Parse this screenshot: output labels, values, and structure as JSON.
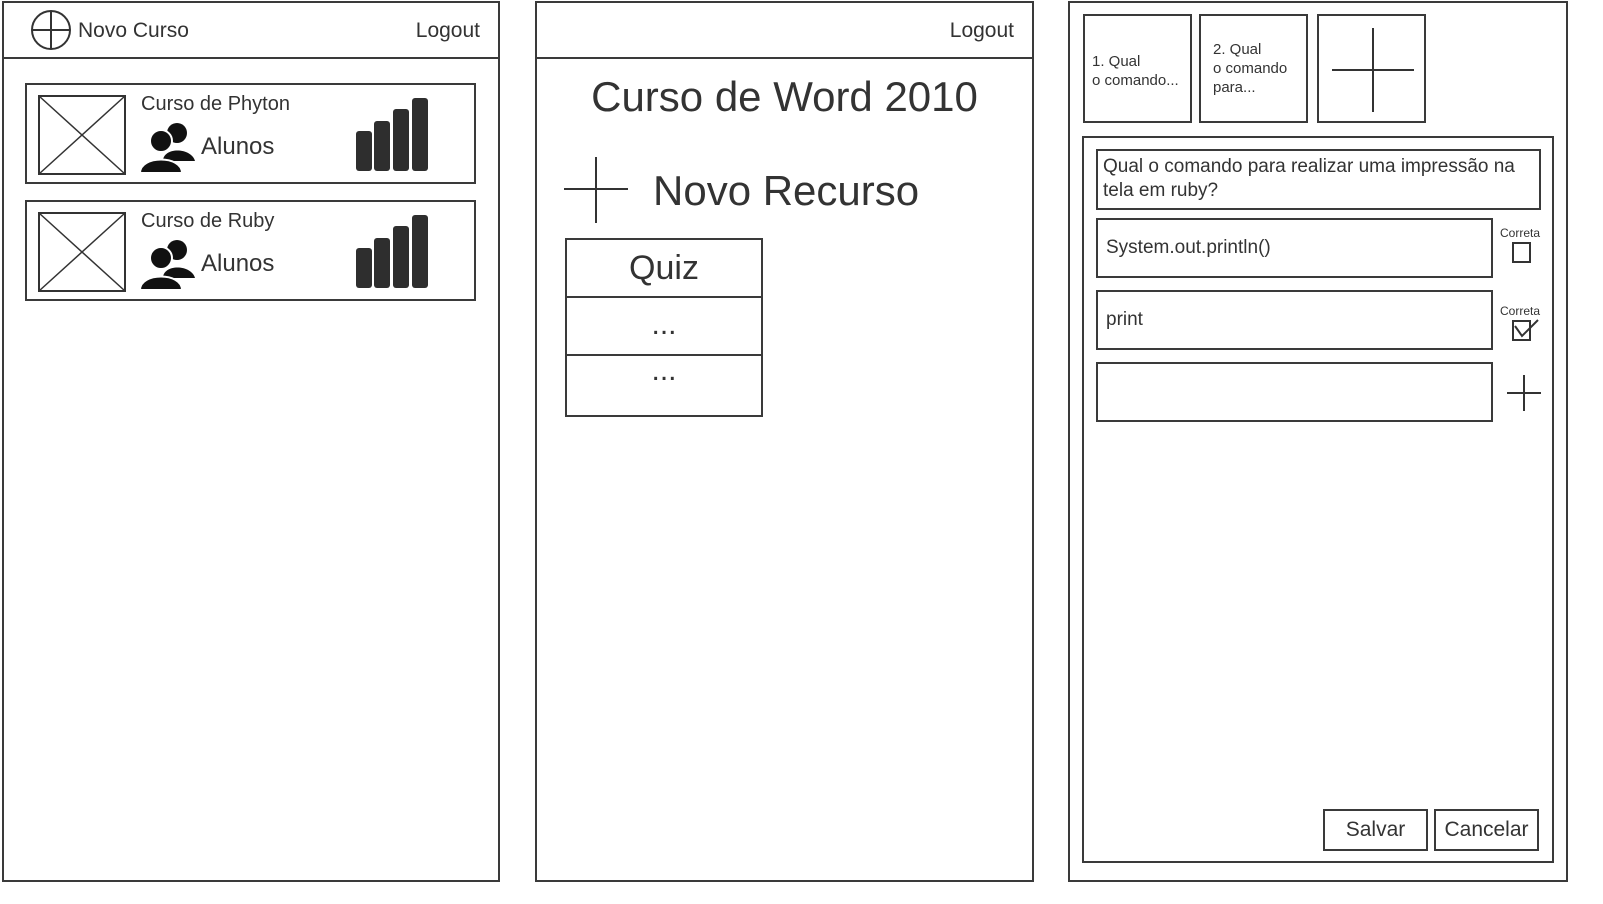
{
  "screen1": {
    "new_course_label": "Novo Curso",
    "logout_label": "Logout",
    "courses": [
      {
        "title": "Curso de Phyton",
        "students_label": "Alunos"
      },
      {
        "title": "Curso de Ruby",
        "students_label": "Alunos"
      }
    ]
  },
  "screen2": {
    "logout_label": "Logout",
    "course_title": "Curso de Word 2010",
    "new_resource_label": "Novo Recurso",
    "resources": [
      "Quiz",
      "...",
      "..."
    ]
  },
  "screen3": {
    "question_tabs": [
      "1. Qual\no comando...",
      "2. Qual\no comando\npara..."
    ],
    "question_text": "Qual o comando para realizar uma impressão na tela em ruby?",
    "answers": [
      {
        "value": "System.out.println()",
        "correct_label": "Correta",
        "correct": false
      },
      {
        "value": "print",
        "correct_label": "Correta",
        "correct": true
      },
      {
        "value": "",
        "correct_label": "",
        "correct": false
      }
    ],
    "save_label": "Salvar",
    "cancel_label": "Cancelar"
  }
}
